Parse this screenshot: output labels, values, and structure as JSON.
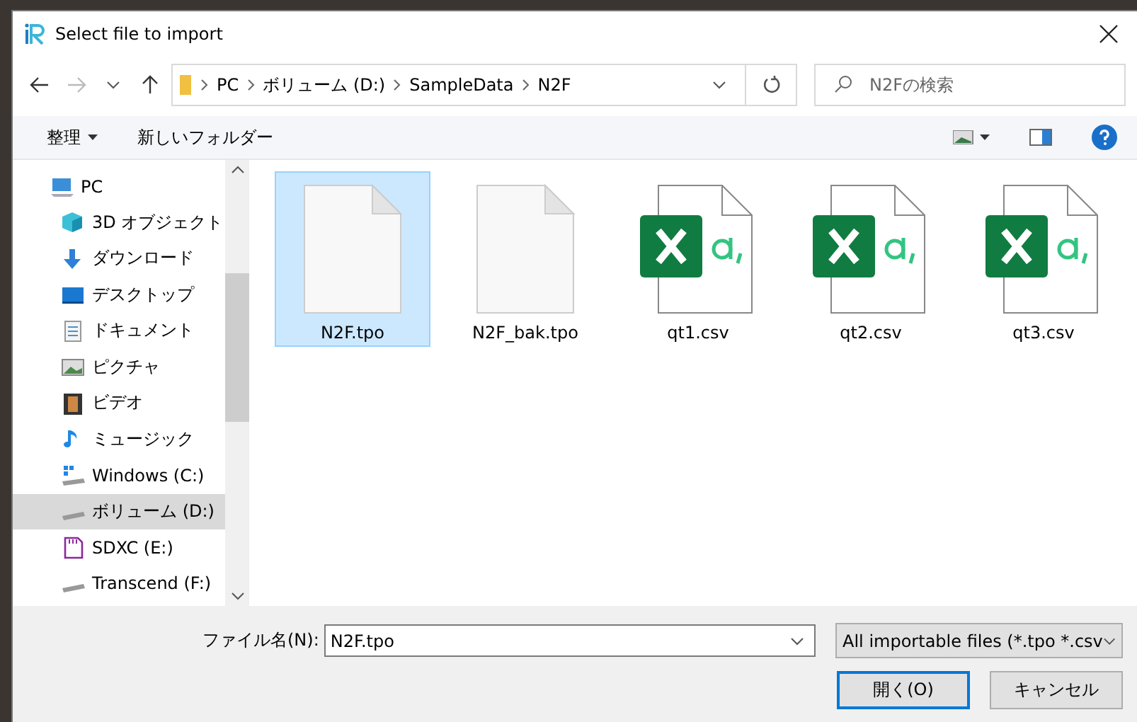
{
  "window": {
    "title": "Select file to import"
  },
  "address": {
    "crumbs": [
      "PC",
      "ボリューム (D:)",
      "SampleData",
      "N2F"
    ]
  },
  "search": {
    "placeholder": "N2Fの検索"
  },
  "toolbar": {
    "organize": "整理",
    "new_folder": "新しいフォルダー"
  },
  "nav": [
    {
      "label": "PC",
      "kind": "pc",
      "selected": false
    },
    {
      "label": "3D オブジェクト",
      "kind": "cube",
      "selected": false
    },
    {
      "label": "ダウンロード",
      "kind": "download",
      "selected": false
    },
    {
      "label": "デスクトップ",
      "kind": "desktop",
      "selected": false
    },
    {
      "label": "ドキュメント",
      "kind": "document",
      "selected": false
    },
    {
      "label": "ピクチャ",
      "kind": "picture",
      "selected": false
    },
    {
      "label": "ビデオ",
      "kind": "video",
      "selected": false
    },
    {
      "label": "ミュージック",
      "kind": "music",
      "selected": false
    },
    {
      "label": "Windows (C:)",
      "kind": "windrive",
      "selected": false
    },
    {
      "label": "ボリューム (D:)",
      "kind": "drive",
      "selected": true
    },
    {
      "label": "SDXC (E:)",
      "kind": "sd",
      "selected": false
    },
    {
      "label": "Transcend (F:)",
      "kind": "drive",
      "selected": false
    }
  ],
  "files": [
    {
      "name": "N2F.tpo",
      "kind": "blank",
      "selected": true
    },
    {
      "name": "N2F_bak.tpo",
      "kind": "blank",
      "selected": false
    },
    {
      "name": "qt1.csv",
      "kind": "csv",
      "selected": false
    },
    {
      "name": "qt2.csv",
      "kind": "csv",
      "selected": false
    },
    {
      "name": "qt3.csv",
      "kind": "csv",
      "selected": false
    }
  ],
  "footer": {
    "filename_label": "ファイル名(N):",
    "filename": "N2F.tpo",
    "filter": "All importable files (*.tpo *.csv",
    "open": "開く(O)",
    "cancel": "キャンセル"
  }
}
